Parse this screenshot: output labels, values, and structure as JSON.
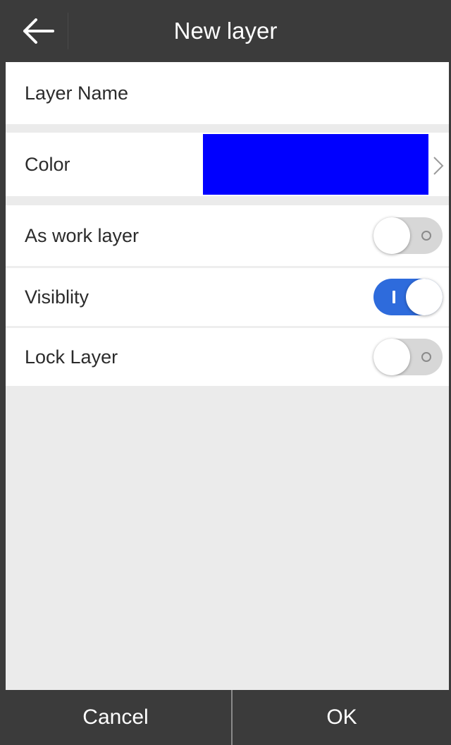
{
  "header": {
    "title": "New layer",
    "back_icon": "arrow-left-icon"
  },
  "form": {
    "layer_name_label": "Layer Name",
    "color_label": "Color",
    "color_value": "#0000ff",
    "work_layer_label": "As work layer",
    "work_layer_on": false,
    "visibility_label": "Visiblity",
    "visibility_on": true,
    "lock_layer_label": "Lock Layer",
    "lock_layer_on": false
  },
  "footer": {
    "cancel_label": "Cancel",
    "ok_label": "OK"
  },
  "colors": {
    "header_bg": "#3b3b3b",
    "toggle_on": "#2e6bdc",
    "toggle_off": "#d7d7d7"
  }
}
